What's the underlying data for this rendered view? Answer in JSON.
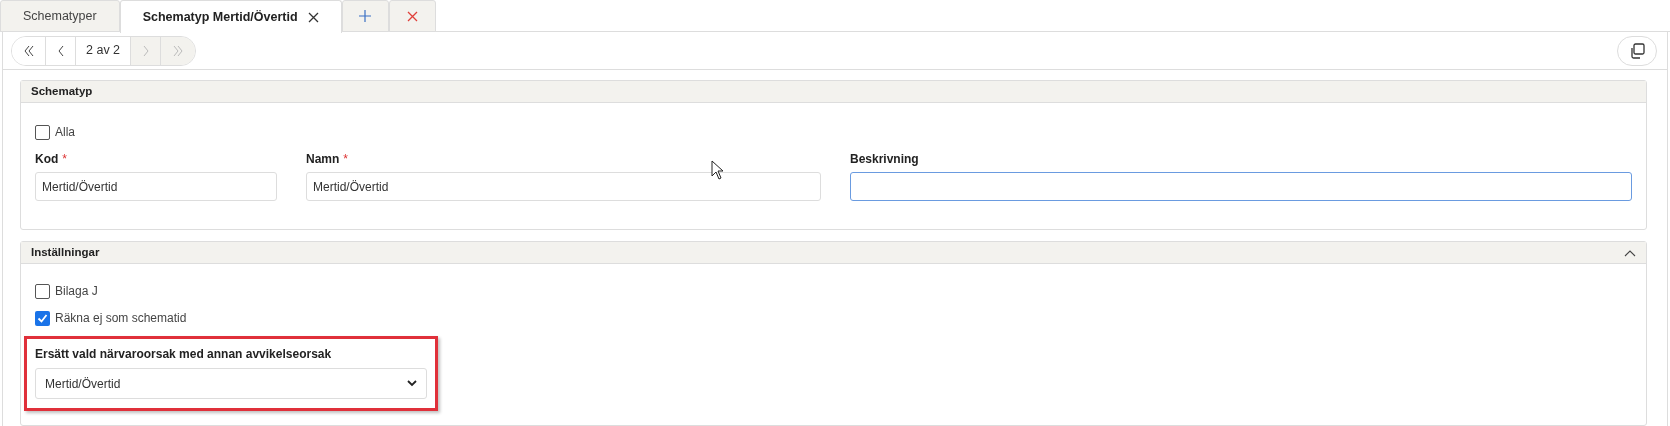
{
  "tabs": [
    {
      "label": "Schematyper",
      "selected": false,
      "closable": false
    },
    {
      "label": "Schematyp Mertid/Övertid",
      "selected": true,
      "closable": true
    }
  ],
  "tab_actions": [
    {
      "kind": "add"
    },
    {
      "kind": "close"
    }
  ],
  "pager": {
    "buttons": [
      {
        "kind": "first",
        "disabled": false
      },
      {
        "kind": "prev",
        "disabled": false
      },
      {
        "kind": "next",
        "disabled": true
      },
      {
        "kind": "last",
        "disabled": true
      }
    ],
    "label": "2 av 2"
  },
  "sections": [
    {
      "title": "Schematyp",
      "items": [
        {
          "kind": "checkbox",
          "label": "Alla",
          "checked": false
        },
        {
          "kind": "fields",
          "fields": [
            {
              "label": "Kod",
              "required_mark": "*",
              "value": "Mertid/Övertid",
              "focused": false
            },
            {
              "label": "Namn",
              "required_mark": "*",
              "value": "Mertid/Övertid",
              "focused": false
            },
            {
              "label": "Beskrivning",
              "focused": true
            }
          ]
        }
      ]
    },
    {
      "title": "Inställningar",
      "expanded": true,
      "items": [
        {
          "kind": "checkbox",
          "label": "Bilaga J",
          "checked": false
        },
        {
          "kind": "checkbox",
          "label": "Räkna ej som schematid",
          "checked": true
        },
        {
          "kind": "select",
          "label": "Ersätt vald närvaroorsak med annan avvikelseorsak",
          "value": "Mertid/Övertid",
          "highlighted": true
        }
      ]
    }
  ]
}
